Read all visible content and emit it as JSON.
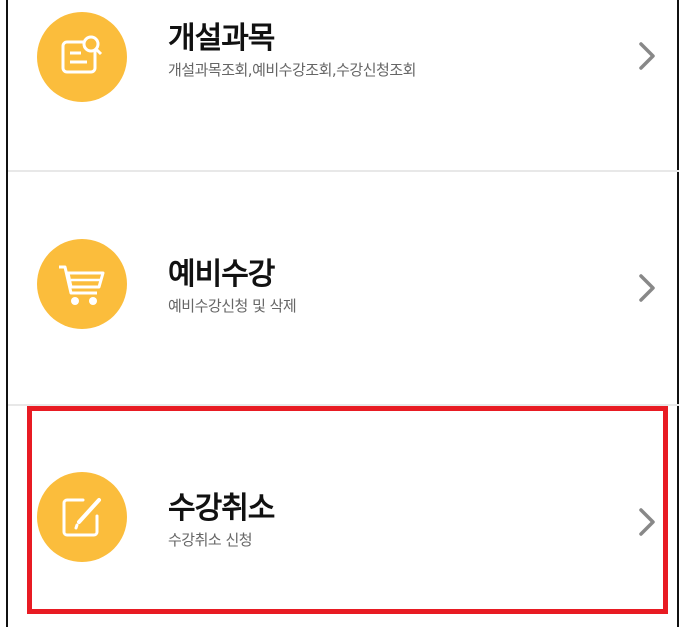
{
  "menu": {
    "items": [
      {
        "title": "개설과목",
        "subtitle": "개설과목조회,예비수강조회,수강신청조회",
        "icon": "search-document-icon"
      },
      {
        "title": "예비수강",
        "subtitle": "예비수강신청 및 삭제",
        "icon": "shopping-cart-icon"
      },
      {
        "title": "수강취소",
        "subtitle": "수강취소 신청",
        "icon": "edit-icon"
      }
    ]
  },
  "colors": {
    "icon_bg": "#fbbd3c",
    "highlight": "#e81b23",
    "chevron": "#888888"
  }
}
